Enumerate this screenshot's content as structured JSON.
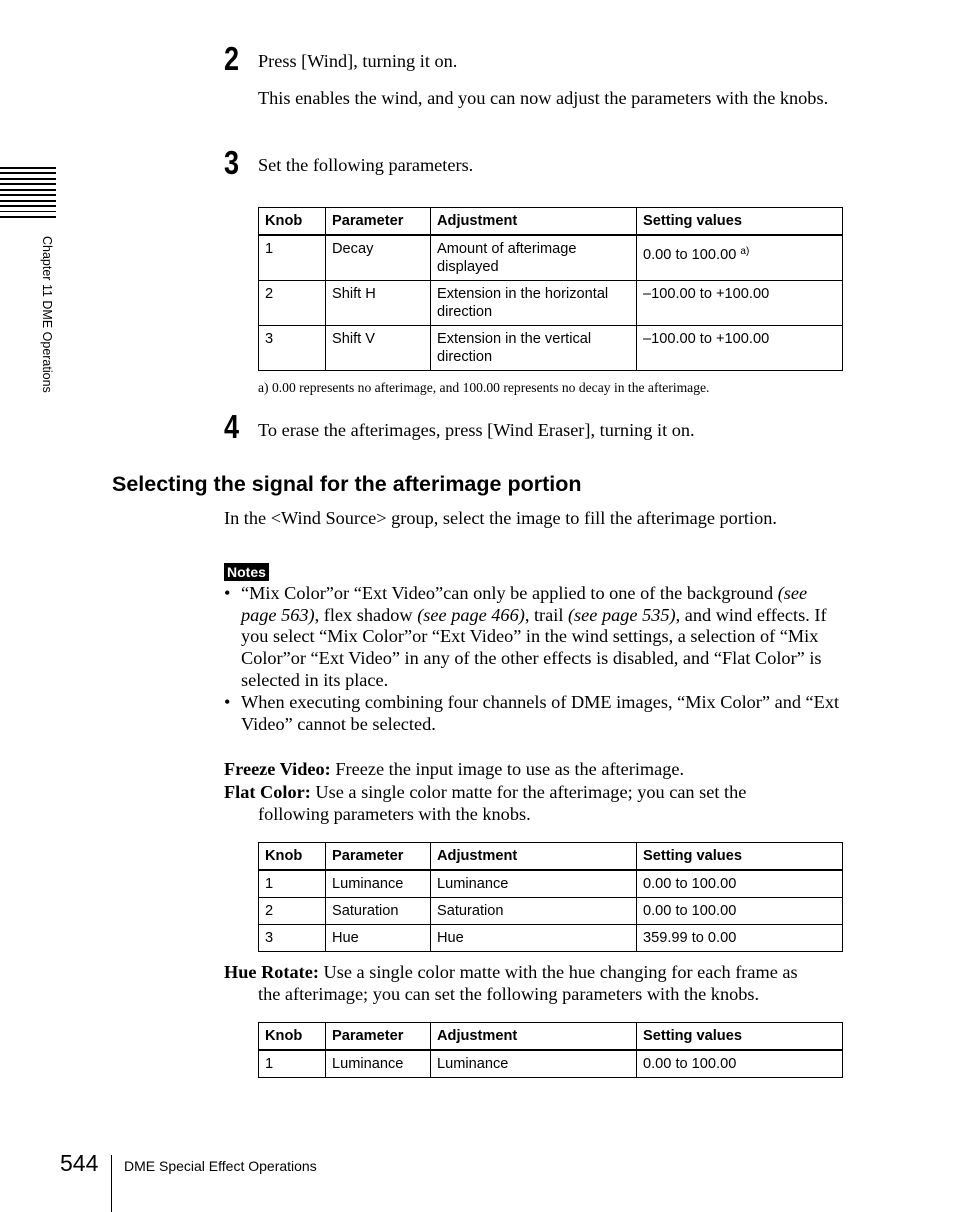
{
  "side_tab": {
    "chapter_label": "Chapter 11   DME Operations",
    "stripe_count": 10
  },
  "steps": [
    {
      "number": "2",
      "text": "Press [Wind], turning it on.",
      "detail": "This enables the wind, and you can now adjust the parameters with the knobs."
    },
    {
      "number": "3",
      "text": "Set the following parameters."
    },
    {
      "number": "4",
      "text": "To erase the afterimages, press [Wind Eraser], turning it on."
    }
  ],
  "table_wind": {
    "headers": [
      "Knob",
      "Parameter",
      "Adjustment",
      "Setting values"
    ],
    "rows": [
      {
        "knob": "1",
        "parameter": "Decay",
        "adjustment": "Amount of afterimage displayed",
        "values": "0.00 to 100.00",
        "note_ref": "a)"
      },
      {
        "knob": "2",
        "parameter": "Shift H",
        "adjustment": "Extension in the horizontal direction",
        "values": "–100.00 to +100.00"
      },
      {
        "knob": "3",
        "parameter": "Shift V",
        "adjustment": "Extension in the vertical direction",
        "values": "–100.00 to +100.00"
      }
    ],
    "footnote": "a) 0.00 represents no afterimage, and 100.00 represents no decay in the afterimage."
  },
  "section": {
    "heading": "Selecting the signal for the afterimage portion",
    "intro": "In the <Wind Source> group, select the image to fill the afterimage portion."
  },
  "notes": {
    "badge": "Notes",
    "bullet_char": "•",
    "items": [
      {
        "parts": [
          {
            "t": "“Mix Color”or “Ext Video”can only be applied to one of the background ",
            "i": false
          },
          {
            "t": "(see page 563)",
            "i": true
          },
          {
            "t": ", flex shadow ",
            "i": false
          },
          {
            "t": "(see page 466)",
            "i": true
          },
          {
            "t": ", trail ",
            "i": false
          },
          {
            "t": "(see page 535)",
            "i": true
          },
          {
            "t": ", and wind effects. If you select “Mix Color”or “Ext Video” in the wind settings, a selection of “Mix Color”or “Ext Video” in any of the other effects is disabled, and “Flat Color” is selected in its place.",
            "i": false
          }
        ]
      },
      {
        "parts": [
          {
            "t": "When executing combining four channels of DME images, “Mix Color” and “Ext Video” cannot be selected.",
            "i": false
          }
        ]
      }
    ]
  },
  "terms": [
    {
      "term": "Freeze Video:",
      "line1": "Freeze the input image to use as the afterimage.",
      "line2": ""
    },
    {
      "term": "Flat Color:",
      "line1": "Use a single color matte for the afterimage; you can set the",
      "line2": "following parameters with the knobs."
    },
    {
      "term": "Hue Rotate:",
      "line1": "Use a single color matte with the hue changing for each frame as",
      "line2": "the afterimage; you can set the following parameters with the knobs."
    }
  ],
  "table_flat_color": {
    "headers": [
      "Knob",
      "Parameter",
      "Adjustment",
      "Setting values"
    ],
    "rows": [
      {
        "knob": "1",
        "parameter": "Luminance",
        "adjustment": "Luminance",
        "values": "0.00 to 100.00"
      },
      {
        "knob": "2",
        "parameter": "Saturation",
        "adjustment": "Saturation",
        "values": "0.00 to 100.00"
      },
      {
        "knob": "3",
        "parameter": "Hue",
        "adjustment": "Hue",
        "values": "359.99 to 0.00"
      }
    ]
  },
  "table_hue_rotate": {
    "headers": [
      "Knob",
      "Parameter",
      "Adjustment",
      "Setting values"
    ],
    "rows": [
      {
        "knob": "1",
        "parameter": "Luminance",
        "adjustment": "Luminance",
        "values": "0.00 to 100.00"
      }
    ]
  },
  "footer": {
    "page_number": "544",
    "title": "DME Special Effect Operations"
  }
}
